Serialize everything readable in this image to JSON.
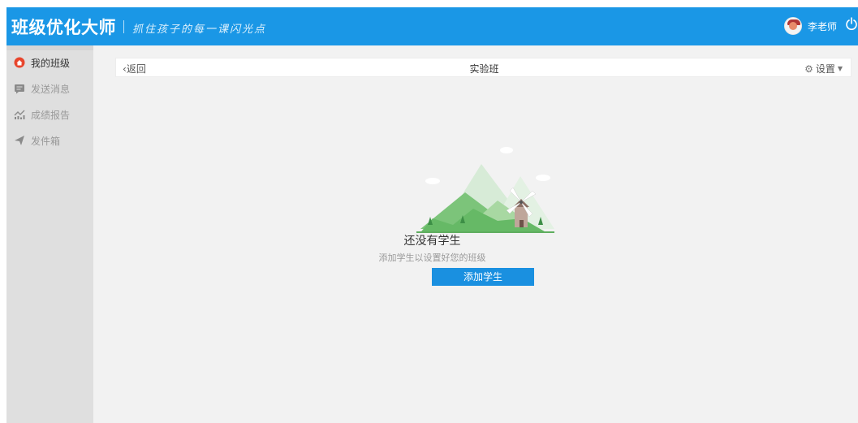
{
  "header": {
    "brand": "班级优化大师",
    "slogan": "抓住孩子的每一课闪光点",
    "username": "李老师",
    "avatar_icon": "user-avatar",
    "power_icon": "power-icon",
    "bg_color": "#1a97e6"
  },
  "sidebar": {
    "items": [
      {
        "label": "我的班级",
        "icon": "home-icon",
        "active": true
      },
      {
        "label": "发送消息",
        "icon": "message-icon",
        "active": false
      },
      {
        "label": "成绩报告",
        "icon": "chart-icon",
        "active": false
      },
      {
        "label": "发件箱",
        "icon": "send-icon",
        "active": false
      }
    ]
  },
  "toolbar": {
    "back_label": "返回",
    "back_icon": "chevron-left-icon",
    "class_name": "实验班",
    "settings_label": "设置",
    "settings_icon": "gear-icon",
    "dropdown_icon": "caret-down-icon"
  },
  "empty_state": {
    "illustration": "windmill-mountains-illustration",
    "title": "还没有学生",
    "subtitle": "添加学生以设置好您的班级",
    "button_label": "添加学生",
    "accent_color": "#1a90e0"
  }
}
